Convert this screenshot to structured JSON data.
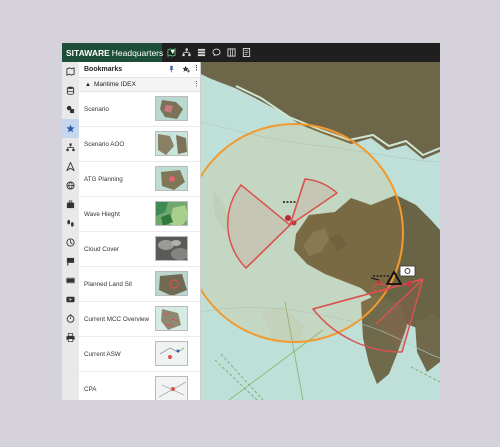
{
  "app": {
    "brand": "SITAWARE",
    "title": "Headquarters",
    "toolbar_icons": [
      "map-icon",
      "hierarchy-icon",
      "layers-icon",
      "chat-icon",
      "grid-icon",
      "document-icon"
    ]
  },
  "rail_icons": [
    "map-layers-icon",
    "database-icon",
    "shapes-icon",
    "star-icon",
    "hierarchy-icon",
    "navigation-arrow-icon",
    "globe-icon",
    "briefcase-icon",
    "footprints-icon",
    "history-icon",
    "flag-icon",
    "film-icon",
    "video-icon",
    "timer-icon",
    "printer-icon"
  ],
  "bookmarks": {
    "title": "Bookmarks",
    "group": "Maritime IDEX",
    "items": [
      {
        "label": "Scenario"
      },
      {
        "label": "Scenario AOO"
      },
      {
        "label": "ATG Planning"
      },
      {
        "label": "Wave Hieght"
      },
      {
        "label": "Cloud Cover"
      },
      {
        "label": "Planned Land Sit"
      },
      {
        "label": "Current MCC Overview"
      },
      {
        "label": "Current ASW"
      },
      {
        "label": "CPA"
      }
    ]
  },
  "colors": {
    "brand": "#1c4e3a",
    "topbar": "#1f1f1f",
    "range_ring": "#f29a2e",
    "sector": "#d9534f",
    "water": "#bfe0d8",
    "land": "#6e6648"
  }
}
